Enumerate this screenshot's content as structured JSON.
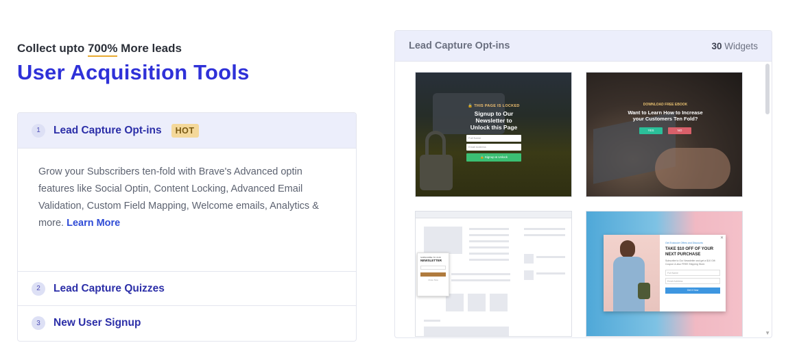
{
  "hero": {
    "kicker_prefix": "Collect upto ",
    "kicker_highlight": "700%",
    "kicker_suffix": " More leads",
    "title": "User Acquisition Tools"
  },
  "accordion": {
    "items": [
      {
        "num": "1",
        "label": "Lead Capture Opt-ins",
        "badge": "HOT",
        "active": true,
        "body": "Grow your Subscribers ten-fold with Brave's Advanced optin features like Social Optin, Content Locking, Advanced Email Validation, Custom Field Mapping, Welcome emails, Analytics & more. ",
        "more": "Learn More"
      },
      {
        "num": "2",
        "label": "Lead Capture Quizzes"
      },
      {
        "num": "3",
        "label": "New User Signup"
      }
    ]
  },
  "panel": {
    "title": "Lead Capture Opt-ins",
    "count": "30",
    "count_label": " Widgets"
  },
  "previews": {
    "lock": {
      "small": "🔒 THIS PAGE IS LOCKED",
      "title": "Signup to Our Newsletter to Unlock this Page",
      "field1": "Full Name",
      "field2": "Email Address",
      "button": "🔒 Signup & Unlock"
    },
    "ebook": {
      "small": "DOWNLOAD FREE EBOOK",
      "title": "Want to Learn How to Increase your Customers Ten Fold?",
      "yes": "YES",
      "no": "NO"
    },
    "newsletter": {
      "small": "SUBSCRIBE TO OUR",
      "title": "NEWSLETTER",
      "close": "Close Now"
    },
    "purchase": {
      "small": "Get Exclusive Offers and Discounts",
      "title": "TAKE $10 OFF OF YOUR NEXT PURCHASE",
      "desc": "Subscribe to Our Newsletter and get a $10 Gift Coupon & also FREE Shipping Store.",
      "field1": "Full Name",
      "field2": "Email Address",
      "button": "Get It Now"
    }
  },
  "colors": {
    "title": "#2f31d8",
    "accent_underline": "#e8a92f",
    "active_bg": "#eceefb",
    "badge_bg": "#f4d89a",
    "link": "#2f4bd6"
  }
}
